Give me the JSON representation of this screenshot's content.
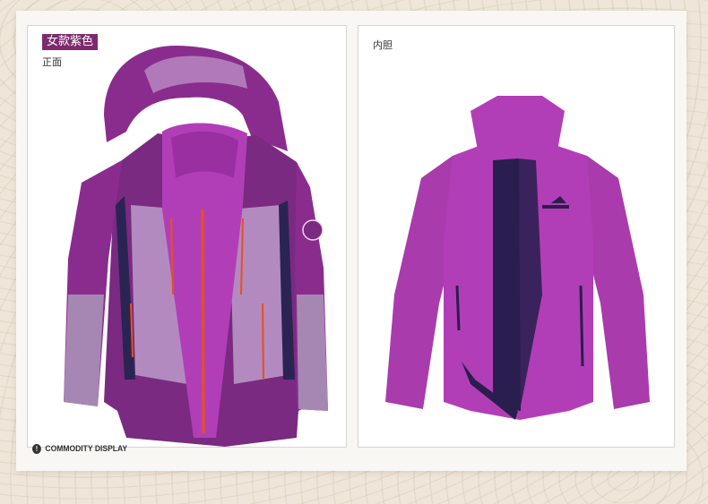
{
  "left_panel": {
    "badge": "女款紫色",
    "subtitle": "正面",
    "image": "purple-3in1-jacket-front"
  },
  "right_panel": {
    "label": "内胆",
    "image": "purple-fleece-inner-jacket"
  },
  "footer": {
    "icon": "info-icon",
    "text": "COMMODITY DISPLAY"
  },
  "colors": {
    "badge_bg": "#7d2a6e",
    "jacket_purple": "#8d2a8f",
    "fleece_magenta": "#b23eb7",
    "accent_orange": "#e8501c",
    "navy": "#2a2452"
  }
}
